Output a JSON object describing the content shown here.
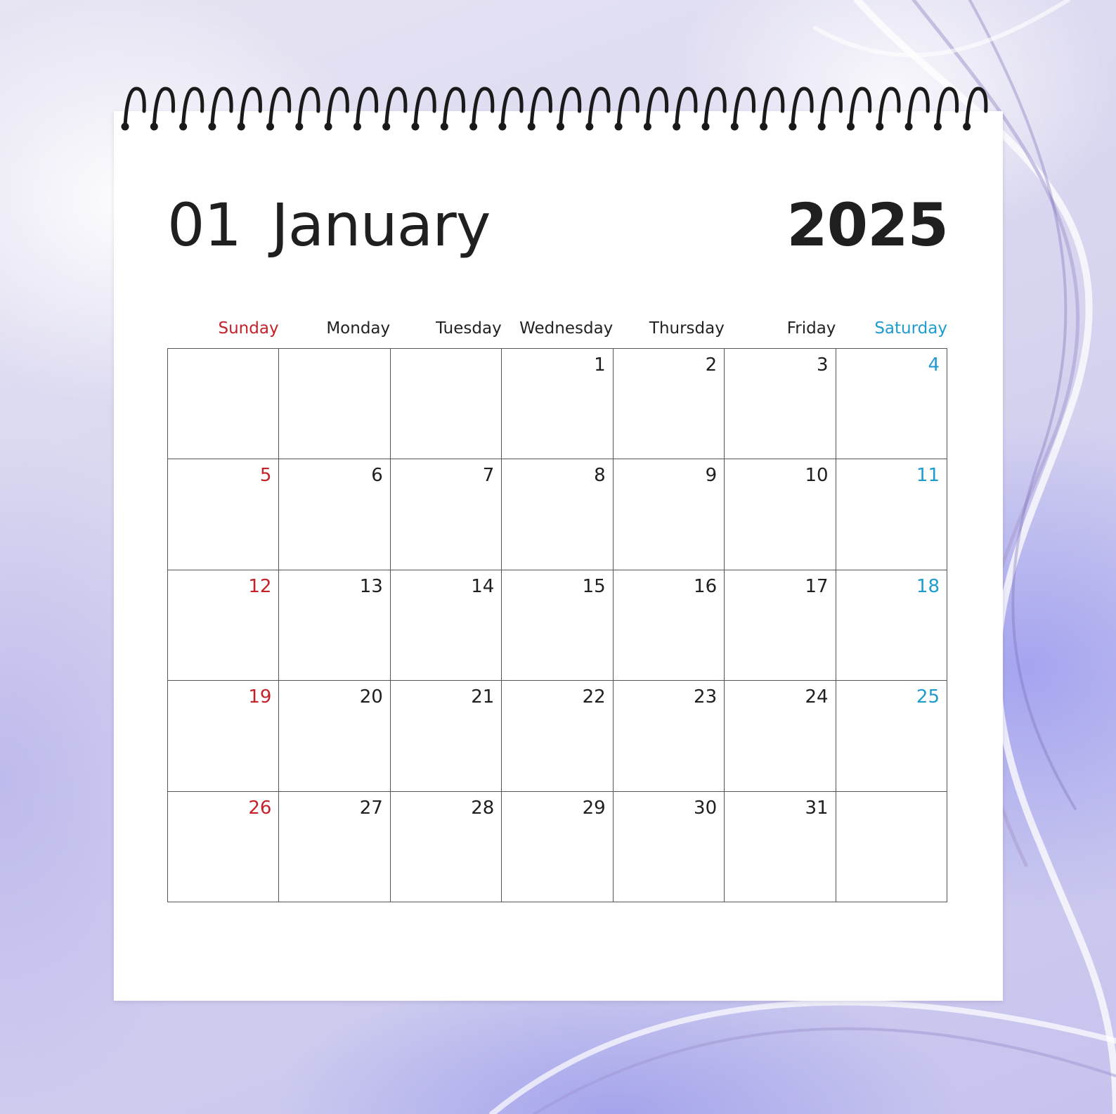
{
  "calendar": {
    "month_number": "01",
    "month_name": "January",
    "year": "2025",
    "weekdays": [
      "Sunday",
      "Monday",
      "Tuesday",
      "Wednesday",
      "Thursday",
      "Friday",
      "Saturday"
    ],
    "weeks": [
      [
        "",
        "",
        "",
        "1",
        "2",
        "3",
        "4"
      ],
      [
        "5",
        "6",
        "7",
        "8",
        "9",
        "10",
        "11"
      ],
      [
        "12",
        "13",
        "14",
        "15",
        "16",
        "17",
        "18"
      ],
      [
        "19",
        "20",
        "21",
        "22",
        "23",
        "24",
        "25"
      ],
      [
        "26",
        "27",
        "28",
        "29",
        "30",
        "31",
        ""
      ]
    ],
    "colors": {
      "sunday": "#c4212a",
      "saturday": "#1e9ccd",
      "weekday": "#1f1f1f",
      "grid_line": "#555555",
      "spiral": "#1a1a1a"
    }
  }
}
